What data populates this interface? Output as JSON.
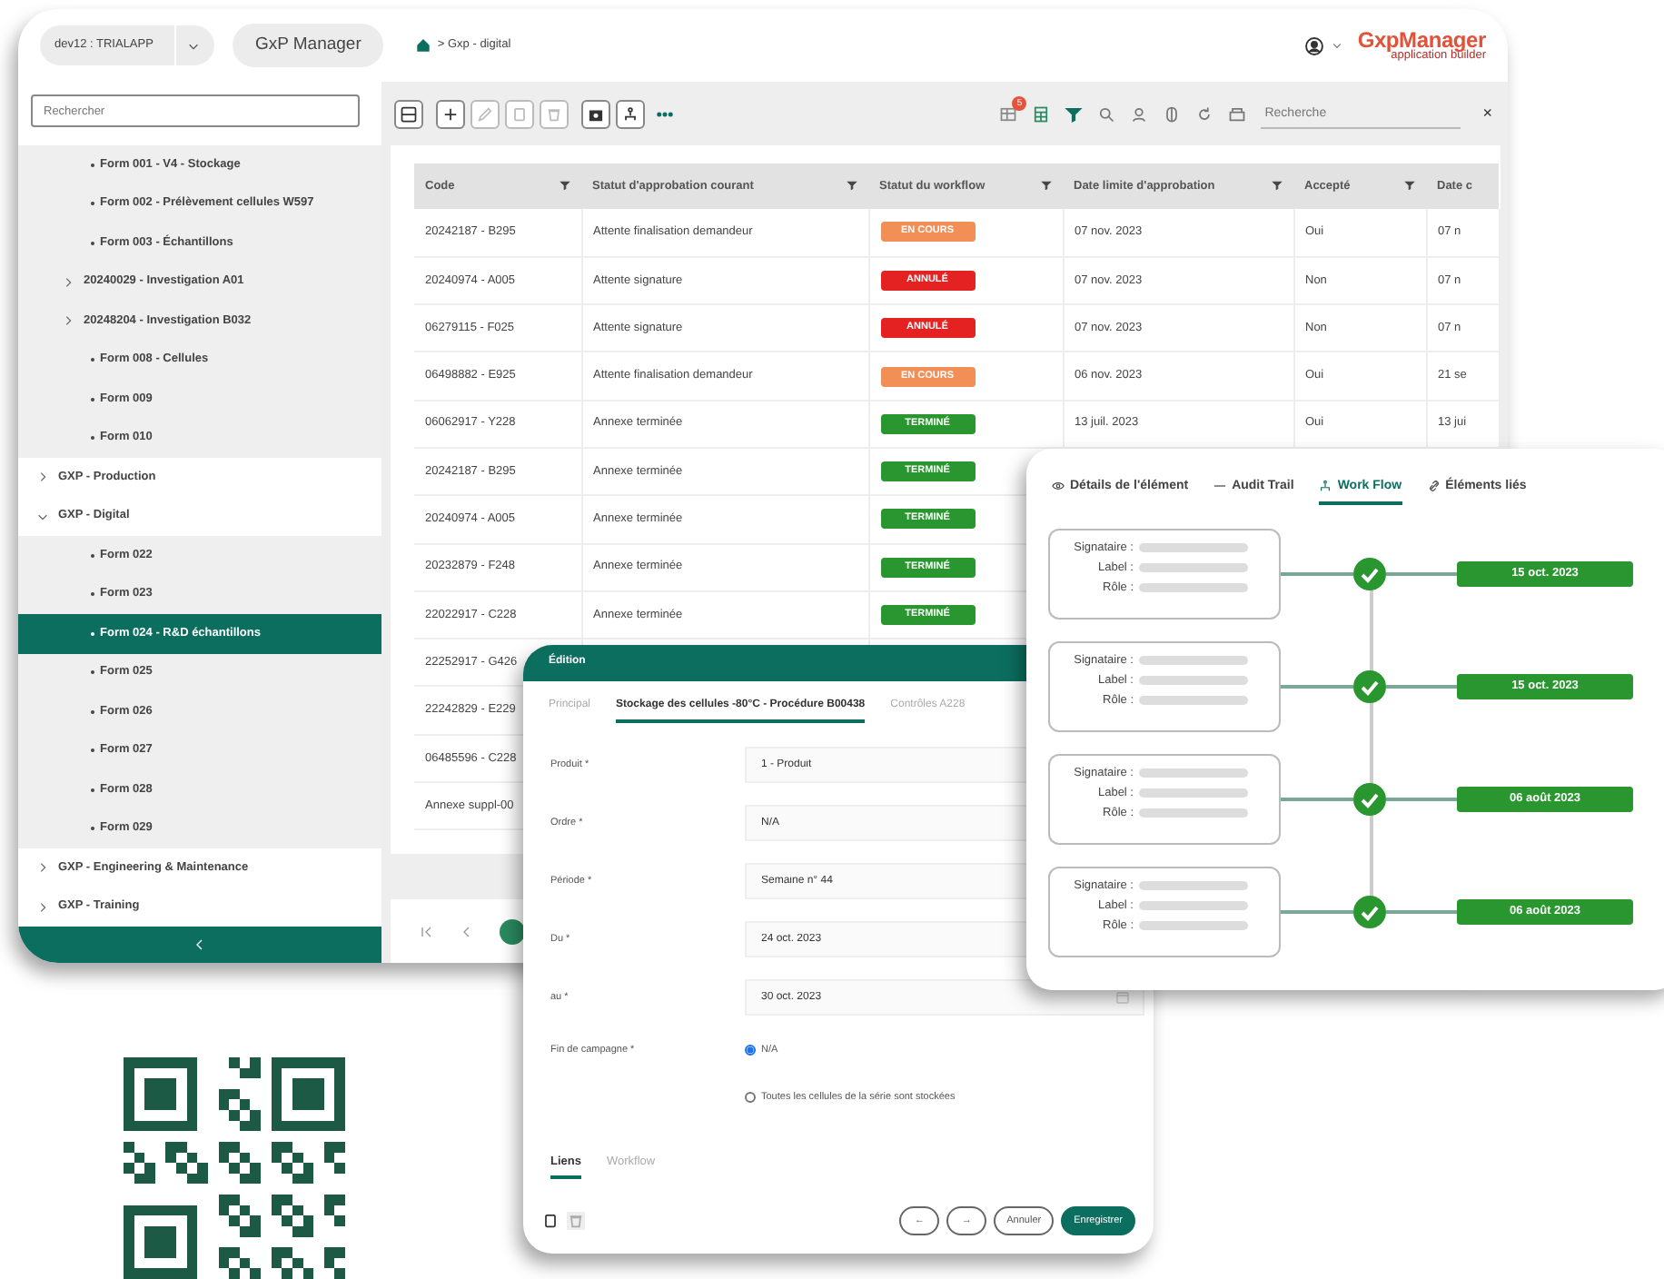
{
  "app": {
    "environment": "dev12 : TRIALAPP",
    "app_name": "GxP Manager",
    "breadcrumb": "> Gxp - digital",
    "logo_name": "GxpManager",
    "logo_tagline": "application builder"
  },
  "sidebar": {
    "search_placeholder": "Rechercher",
    "tree": [
      {
        "label": "Form 001 - V4 - Stockage",
        "kind": "leaf",
        "selected": false
      },
      {
        "label": "Form 002 - Prélèvement cellules W597",
        "kind": "leaf",
        "selected": false
      },
      {
        "label": "Form 003 - Échantillons",
        "kind": "leaf",
        "selected": false
      },
      {
        "label": "20240029 - Investigation A01",
        "kind": "group",
        "expanded": false,
        "selected": false
      },
      {
        "label": "20248204 - Investigation B032",
        "kind": "group",
        "expanded": false,
        "selected": false
      },
      {
        "label": "Form 008 - Cellules",
        "kind": "leaf",
        "selected": false
      },
      {
        "label": "Form 009",
        "kind": "leaf",
        "selected": false
      },
      {
        "label": "Form 010",
        "kind": "leaf",
        "selected": false
      },
      {
        "label": "GXP - Production",
        "kind": "section",
        "expanded": false,
        "selected": false
      },
      {
        "label": "GXP - Digital",
        "kind": "section",
        "expanded": true,
        "selected": false,
        "children": [
          {
            "label": "Form 022",
            "kind": "leaf",
            "selected": false
          },
          {
            "label": "Form 023",
            "kind": "leaf",
            "selected": false
          },
          {
            "label": "Form 024 - R&D échantillons",
            "kind": "leaf",
            "selected": true
          },
          {
            "label": "Form 025",
            "kind": "leaf",
            "selected": false
          },
          {
            "label": "Form 026",
            "kind": "leaf",
            "selected": false
          },
          {
            "label": "Form 027",
            "kind": "leaf",
            "selected": false
          },
          {
            "label": "Form 028",
            "kind": "leaf",
            "selected": false
          },
          {
            "label": "Form 029",
            "kind": "leaf",
            "selected": false
          }
        ]
      },
      {
        "label": "GXP - Engineering & Maintenance",
        "kind": "section",
        "expanded": false,
        "selected": false
      },
      {
        "label": "GXP - Training",
        "kind": "section",
        "expanded": false,
        "selected": false
      }
    ]
  },
  "toolbar": {
    "left_buttons": [
      {
        "kind": "layout",
        "disabled": false
      },
      {
        "kind": "add",
        "disabled": false
      },
      {
        "kind": "edit",
        "disabled": true
      },
      {
        "kind": "copy",
        "disabled": true
      },
      {
        "kind": "delete",
        "disabled": true
      },
      {
        "kind": "camera",
        "disabled": false
      },
      {
        "kind": "hierarchy",
        "disabled": false
      },
      {
        "kind": "more",
        "disabled": false
      }
    ],
    "right_buttons": [
      {
        "kind": "grid",
        "badge": "5"
      },
      {
        "kind": "sheet"
      },
      {
        "kind": "filter"
      },
      {
        "kind": "search"
      },
      {
        "kind": "user"
      },
      {
        "kind": "columns"
      },
      {
        "kind": "refresh"
      },
      {
        "kind": "box"
      }
    ],
    "search_placeholder": "Recherche",
    "clear": "×"
  },
  "table": {
    "columns": [
      "Code",
      "Statut d'approbation courant",
      "Statut du workflow",
      "Date limite d'approbation",
      "Accepté",
      "Date c"
    ],
    "rows": [
      {
        "code": "20242187 - B295",
        "approval": "Attente finalisation demandeur",
        "workflow": {
          "label": "EN COURS",
          "color": "#f28f56"
        },
        "deadline": "07 nov. 2023",
        "accepted": "Oui",
        "date_c": "07 n"
      },
      {
        "code": "20240974 - A005",
        "approval": "Attente signature",
        "workflow": {
          "label": "ANNULÉ",
          "color": "#e52222"
        },
        "deadline": "07 nov. 2023",
        "accepted": "Non",
        "date_c": "07 n"
      },
      {
        "code": "06279115 - F025",
        "approval": "Attente signature",
        "workflow": {
          "label": "ANNULÉ",
          "color": "#e52222"
        },
        "deadline": "07 nov. 2023",
        "accepted": "Non",
        "date_c": "07 n"
      },
      {
        "code": "06498882 - E925",
        "approval": "Attente finalisation demandeur",
        "workflow": {
          "label": "EN COURS",
          "color": "#f28f56"
        },
        "deadline": "06 nov. 2023",
        "accepted": "Oui",
        "date_c": "21 se"
      },
      {
        "code": "06062917 - Y228",
        "approval": "Annexe terminée",
        "workflow": {
          "label": "TERMINÉ",
          "color": "#2a962f"
        },
        "deadline": "13 juil. 2023",
        "accepted": "Oui",
        "date_c": "13 jui"
      },
      {
        "code": "20242187 - B295",
        "approval": "Annexe terminée",
        "workflow": {
          "label": "TERMINÉ",
          "color": "#2a962f"
        }
      },
      {
        "code": "20240974 - A005",
        "approval": "Annexe terminée",
        "workflow": {
          "label": "TERMINÉ",
          "color": "#2a962f"
        }
      },
      {
        "code": "20232879 - F248",
        "approval": "Annexe terminée",
        "workflow": {
          "label": "TERMINÉ",
          "color": "#2a962f"
        }
      },
      {
        "code": "22022917 - C228",
        "approval": "Annexe terminée",
        "workflow": {
          "label": "TERMINÉ",
          "color": "#2a962f"
        }
      },
      {
        "code": "22252917 - G426"
      },
      {
        "code": "22242829 - E229"
      },
      {
        "code": "06485596 - C228"
      },
      {
        "code": "Annexe suppl-00"
      }
    ]
  },
  "workflow_panel": {
    "tabs": [
      {
        "label": "Détails de l'élément",
        "kind": "eye",
        "selected": false
      },
      {
        "label": "Audit Trail",
        "kind": "dash",
        "selected": false
      },
      {
        "label": "Work Flow",
        "kind": "flow",
        "selected": true
      },
      {
        "label": "Éléments liés",
        "kind": "link",
        "selected": false
      }
    ],
    "steps": [
      {
        "fields": [
          "Signataire :",
          "Label :",
          "Rôle :"
        ],
        "date": "15 oct. 2023"
      },
      {
        "fields": [
          "Signataire :",
          "Label :",
          "Rôle :"
        ],
        "date": "15 oct. 2023"
      },
      {
        "fields": [
          "Signataire :",
          "Label :",
          "Rôle :"
        ],
        "date": "06 août 2023"
      },
      {
        "fields": [
          "Signataire :",
          "Label :",
          "Rôle :"
        ],
        "date": "06 août 2023"
      }
    ]
  },
  "edit_dialog": {
    "title": "Édition",
    "tabs": [
      {
        "label": "Principal",
        "selected": false
      },
      {
        "label": "Stockage des cellules -80°C - Procédure B00438",
        "selected": true
      },
      {
        "label": "Contrôles A228",
        "selected": false
      }
    ],
    "fields": [
      {
        "label": "Produit *",
        "value": "1 - Produit",
        "kind": "text"
      },
      {
        "label": "Ordre *",
        "value": "N/A",
        "kind": "text"
      },
      {
        "label": "Période *",
        "value": "Semaine n° 44",
        "kind": "text"
      },
      {
        "label": "Du *",
        "value": "24 oct. 2023",
        "kind": "text"
      },
      {
        "label": "au *",
        "value": "30 oct. 2023",
        "kind": "date"
      }
    ],
    "radio_group": {
      "label": "Fin de campagne *",
      "options": [
        {
          "label": "N/A",
          "selected": true
        },
        {
          "label": "Toutes les cellules de la série sont stockées",
          "selected": false
        }
      ]
    },
    "bottom_tabs": [
      {
        "label": "Liens",
        "selected": true
      },
      {
        "label": "Workflow",
        "selected": false
      }
    ],
    "buttons": [
      {
        "label": "←",
        "kind": "outline"
      },
      {
        "label": "→",
        "kind": "outline"
      },
      {
        "label": "Annuler",
        "kind": "outline"
      },
      {
        "label": "Enregistrer",
        "kind": "primary"
      }
    ]
  }
}
